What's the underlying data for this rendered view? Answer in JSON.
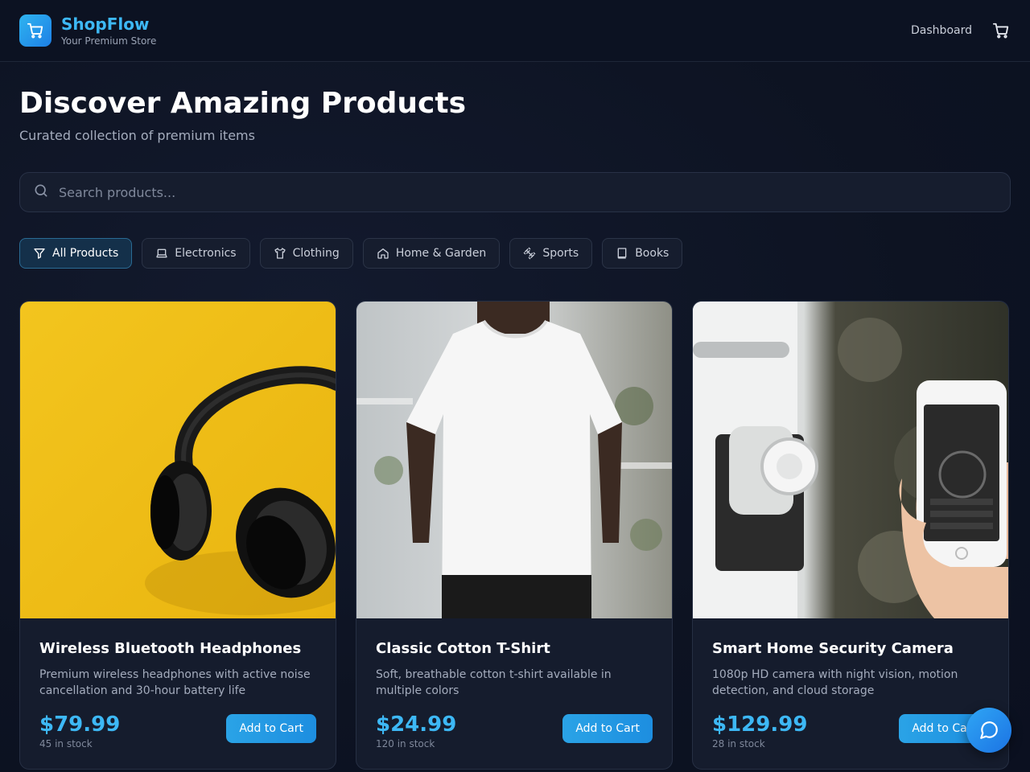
{
  "brand": {
    "name": "ShopFlow",
    "tagline": "Your Premium Store"
  },
  "header": {
    "nav_dashboard": "Dashboard",
    "cart_icon": "shopping-cart-icon"
  },
  "hero": {
    "title": "Discover Amazing Products",
    "subtitle": "Curated collection of premium items"
  },
  "search": {
    "placeholder": "Search products...",
    "value": ""
  },
  "filters": [
    {
      "label": "All Products",
      "icon": "filter-icon",
      "active": true
    },
    {
      "label": "Electronics",
      "icon": "laptop-icon",
      "active": false
    },
    {
      "label": "Clothing",
      "icon": "shirt-icon",
      "active": false
    },
    {
      "label": "Home & Garden",
      "icon": "home-icon",
      "active": false
    },
    {
      "label": "Sports",
      "icon": "dumbbell-icon",
      "active": false
    },
    {
      "label": "Books",
      "icon": "book-icon",
      "active": false
    }
  ],
  "products": [
    {
      "title": "Wireless Bluetooth Headphones",
      "description": "Premium wireless headphones with active noise cancellation and 30-hour battery life",
      "price": "$79.99",
      "stock": "45 in stock",
      "button": "Add to Cart",
      "image": "headphones-photo"
    },
    {
      "title": "Classic Cotton T-Shirt",
      "description": "Soft, breathable cotton t-shirt available in multiple colors",
      "price": "$24.99",
      "stock": "120 in stock",
      "button": "Add to Cart",
      "image": "tshirt-photo"
    },
    {
      "title": "Smart Home Security Camera",
      "description": "1080p HD camera with night vision, motion detection, and cloud storage",
      "price": "$129.99",
      "stock": "28 in stock",
      "button": "Add to Cart",
      "image": "smart-lock-photo"
    }
  ],
  "chat": {
    "icon": "chat-bubble-icon"
  },
  "colors": {
    "accent": "#3db8f5",
    "background": "#0d1322",
    "card": "#151c2d"
  }
}
